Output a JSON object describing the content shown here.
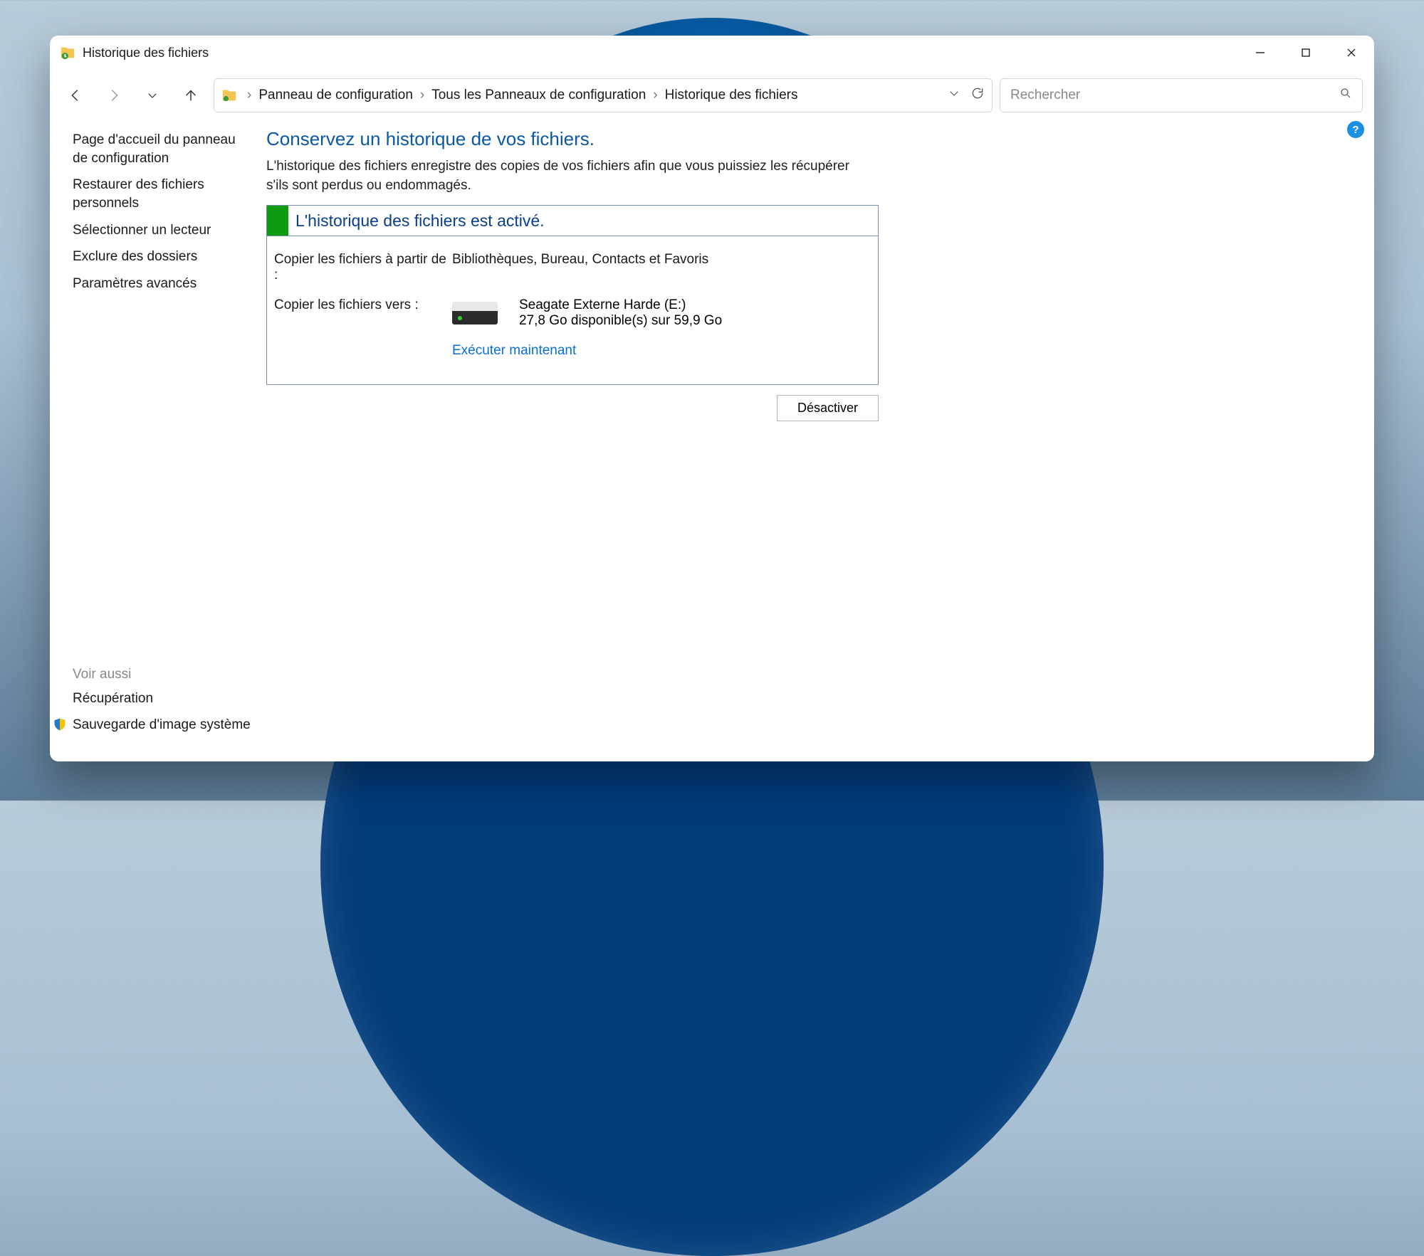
{
  "window": {
    "title": "Historique des fichiers"
  },
  "breadcrumb": {
    "parts": [
      "Panneau de configuration",
      "Tous les Panneaux de configuration",
      "Historique des fichiers"
    ]
  },
  "search": {
    "placeholder": "Rechercher"
  },
  "sidebar": {
    "items": [
      "Page d'accueil du panneau de configuration",
      "Restaurer des fichiers personnels",
      "Sélectionner un lecteur",
      "Exclure des dossiers",
      "Paramètres avancés"
    ],
    "see_also_heading": "Voir aussi",
    "see_also": [
      "Récupération",
      "Sauvegarde d'image système"
    ]
  },
  "main": {
    "title": "Conservez un historique de vos fichiers.",
    "description": "L'historique des fichiers enregistre des copies de vos fichiers afin que vous puissiez les récupérer s'ils sont perdus ou endommagés.",
    "status": "L'historique des fichiers est activé.",
    "copy_from_label": "Copier les fichiers à partir de :",
    "copy_from_value": "Bibliothèques, Bureau, Contacts et Favoris",
    "copy_to_label": "Copier les fichiers vers :",
    "drive_name": "Seagate Externe Harde (E:)",
    "drive_space": "27,8 Go disponible(s) sur 59,9 Go",
    "run_now": "Exécuter maintenant",
    "deactivate": "Désactiver"
  },
  "help_symbol": "?"
}
